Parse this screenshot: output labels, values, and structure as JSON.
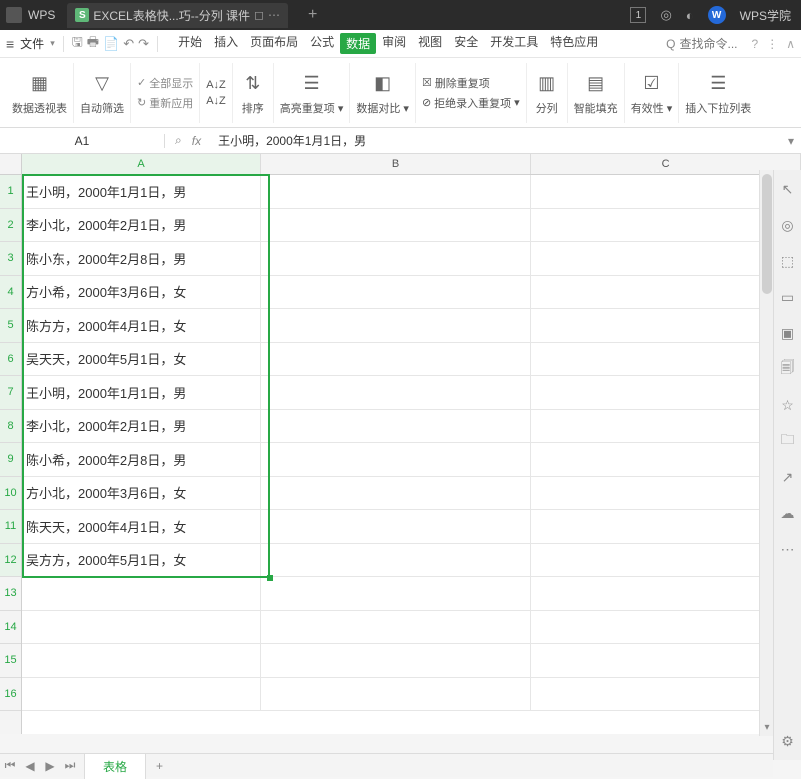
{
  "titlebar": {
    "wps_label": "WPS",
    "tab_filetype": "S",
    "tab_title": "EXCEL表格快...巧--分列 课件",
    "tab_indicator": "◻",
    "badge": "1",
    "user_label": "WPS学院",
    "avatar_initial": "W"
  },
  "menubar": {
    "file": "文件",
    "tabs": [
      "开始",
      "插入",
      "页面布局",
      "公式",
      "数据",
      "审阅",
      "视图",
      "安全",
      "开发工具",
      "特色应用"
    ],
    "active_tab": "数据",
    "search_placeholder": "查找命令...",
    "search_icon": "Q"
  },
  "ribbon": {
    "pivot": "数据透视表",
    "autofilter": "自动筛选",
    "show_all": "全部显示",
    "reapply": "重新应用",
    "sort_asc": "A↓Z",
    "sort_desc": "A↓Z",
    "sort": "排序",
    "highlight_dup": "高亮重复项",
    "data_compare": "数据对比",
    "remove_dup": "删除重复项",
    "reject_dup": "拒绝录入重复项",
    "text_to_cols": "分列",
    "smart_fill": "智能填充",
    "validation": "有效性",
    "dropdown_list": "插入下拉列表"
  },
  "refbar": {
    "cell": "A1",
    "formula": "王小明，2000年1月1日，男"
  },
  "grid": {
    "columns": [
      "A",
      "B",
      "C"
    ],
    "rows": [
      "王小明，2000年1月1日，男",
      "李小北，2000年2月1日，男",
      "陈小东，2000年2月8日，男",
      "方小希，2000年3月6日，女",
      "陈方方，2000年4月1日，女",
      "吴天天，2000年5月1日，女",
      "王小明，2000年1月1日，男",
      "李小北，2000年2月1日，男",
      "陈小希，2000年2月8日，男",
      "方小北，2000年3月6日，女",
      "陈天天，2000年4月1日，女",
      "吴方方，2000年5月1日，女",
      "",
      "",
      "",
      ""
    ]
  },
  "sheetbar": {
    "sheet_name": "表格"
  }
}
